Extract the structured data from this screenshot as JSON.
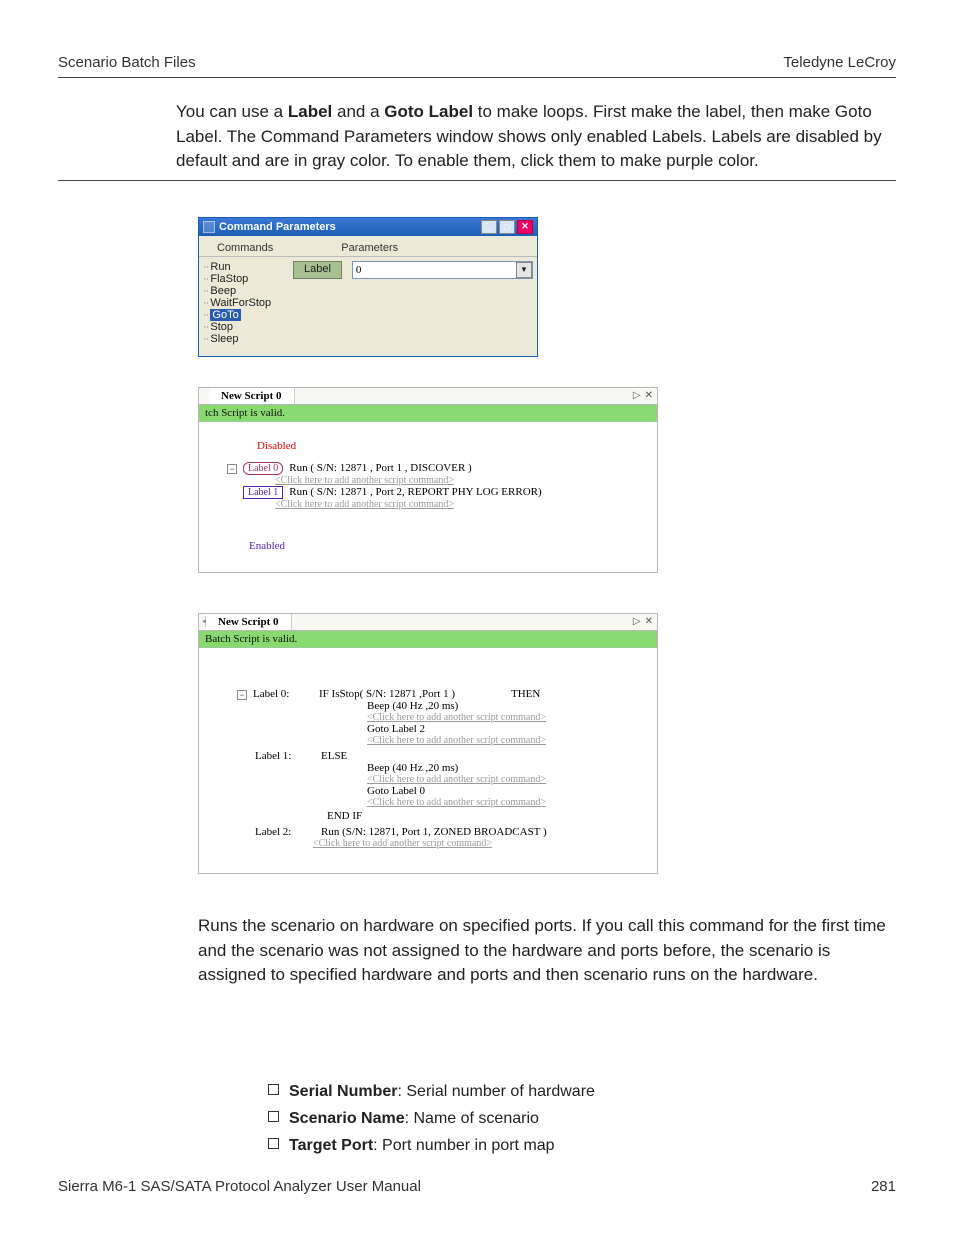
{
  "header": {
    "left": "Scenario Batch Files",
    "right": "Teledyne LeCroy"
  },
  "intro": {
    "p1": "You can use a ",
    "label_b": "Label",
    "p2": " and a ",
    "goto_b": "Goto Label",
    "p3": " to make loops. First make the label, then make Goto Label. The Command Parameters window shows only enabled Labels. Labels are disabled by default and are in gray color. To enable them, click them to make purple color."
  },
  "cmd_params": {
    "title": "Command Parameters",
    "tab_commands": "Commands",
    "tab_parameters": "Parameters",
    "tree": {
      "run": "Run",
      "fla": "FlaStop",
      "beep": "Beep",
      "wait": "WaitForStop",
      "goto": "GoTo",
      "stop": "Stop",
      "sleep": "Sleep"
    },
    "param_label": "Label",
    "param_value": "0"
  },
  "script1": {
    "tab": "New Script 0",
    "valid": "tch Script is valid.",
    "disabled_note": "Disabled",
    "label0": "Label 0",
    "label1": "Label 1",
    "run0": "Run ( S/N: 12871 , Port 1 , DISCOVER )",
    "hint": "<Click here to add another script command>",
    "run1": "Run ( S/N: 12871 , Port 2, REPORT PHY LOG ERROR)",
    "enabled_note": "Enabled"
  },
  "script2": {
    "tab": "New Script 0",
    "valid": "Batch Script is valid.",
    "l0": {
      "label": "Label 0:",
      "ifpart": "IF  IsStop( S/N: 12871 ,Port 1 )",
      "then": "THEN",
      "beep": "Beep (40 Hz ,20 ms)",
      "hint": "<Click here to add another script command>",
      "goto": "Goto Label 2"
    },
    "l1": {
      "label": "Label 1:",
      "else": "ELSE",
      "beep": "Beep (40 Hz ,20 ms)",
      "hint": "<Click here to add another script command>",
      "goto": "Goto Label  0"
    },
    "endif": "END IF",
    "l2": {
      "label": "Label 2:",
      "run": "Run (S/N: 12871, Port 1, ZONED BROADCAST  )",
      "hint": "<Click here to add another script command>"
    }
  },
  "run_para": "Runs the scenario on hardware on specified ports. If you call this command for the first time and the scenario was not assigned to the hardware and ports before, the scenario is assigned to specified hardware and ports and then scenario runs on the hardware.",
  "params": {
    "serial_b": "Serial Number",
    "serial": ": Serial number of hardware",
    "scenario_b": "Scenario Name",
    "scenario": ": Name of scenario",
    "target_b": "Target Port",
    "target": ": Port number in port map"
  },
  "footer": {
    "left": "Sierra M6-1 SAS/SATA Protocol Analyzer User Manual",
    "right": "281"
  }
}
